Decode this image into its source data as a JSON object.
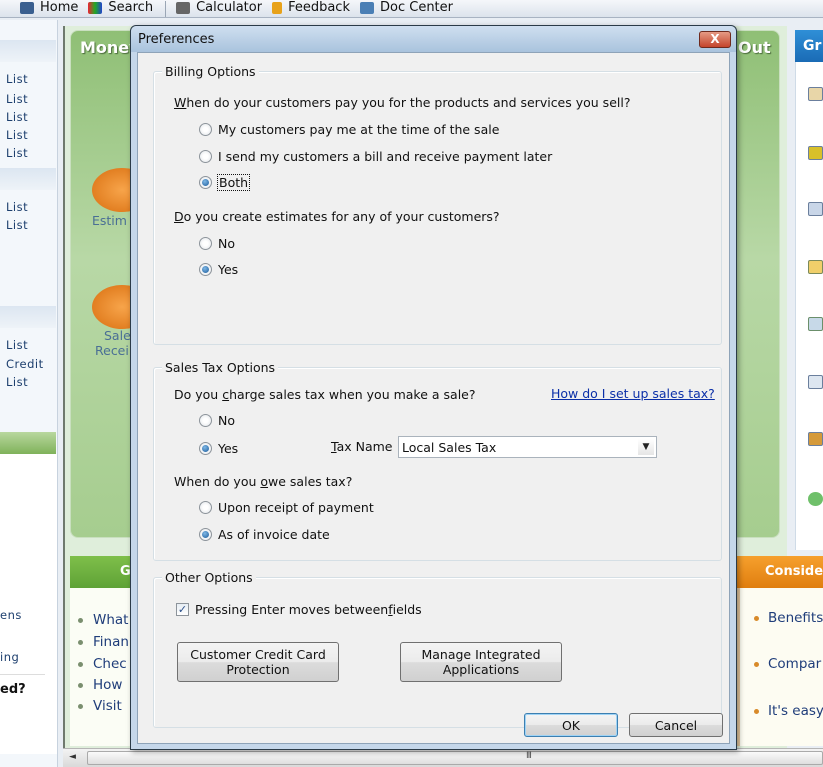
{
  "toolbar": {
    "items": [
      {
        "label": "Home",
        "icon": "home-icon"
      },
      {
        "label": "Search",
        "icon": "search-icon"
      },
      {
        "label": "Calculator",
        "icon": "calculator-icon"
      },
      {
        "label": "Feedback",
        "icon": "feedback-icon"
      },
      {
        "label": "Doc Center",
        "icon": "doc-center-icon"
      }
    ]
  },
  "left_pane": {
    "links_group1": [
      "List",
      "List",
      "List",
      "List",
      "List"
    ],
    "links_group2": [
      "List",
      "List"
    ],
    "links_group3": [
      "List",
      "Credit",
      "List"
    ],
    "fragments": [
      "ens",
      "ing"
    ],
    "question": "ed?"
  },
  "home_panel": {
    "title_left": "Money",
    "title_right": "Out",
    "icon_labels": [
      "Estim",
      "Sale",
      "Recei"
    ],
    "green_box_header": "G",
    "green_box_links": [
      "What",
      "Finan",
      "Chec",
      "How",
      "Visit"
    ],
    "right_header": "Gr",
    "consider_header": "Conside",
    "consider_links": [
      "Benefits",
      "Compar",
      "It's easy"
    ]
  },
  "dialog": {
    "title": "Preferences",
    "close_label": "X",
    "billing": {
      "legend": "Billing Options",
      "q1": {
        "prefix_u": "W",
        "rest": "hen do your customers pay you for the products and services you sell?"
      },
      "q1_options": [
        {
          "label": "My customers pay me at the time of the sale",
          "selected": false
        },
        {
          "label": "I send my customers a bill and receive payment later",
          "selected": false
        },
        {
          "label": "Both",
          "selected": true
        }
      ],
      "q2": {
        "prefix_u": "D",
        "rest": "o you create estimates for any of your customers?"
      },
      "q2_options": [
        {
          "label": "No",
          "selected": false
        },
        {
          "label": "Yes",
          "selected": true
        }
      ]
    },
    "sales_tax": {
      "legend": "Sales Tax Options",
      "q1": {
        "before": "Do you ",
        "u": "c",
        "after": "harge sales tax when you make a sale?"
      },
      "help_link": "How do I set up sales tax?",
      "q1_options": [
        {
          "label": "No",
          "selected": false
        },
        {
          "label": "Yes",
          "selected": true
        }
      ],
      "tax_name_label_u": "T",
      "tax_name_label_rest": "ax Name",
      "tax_name_value": "Local Sales Tax",
      "q2": {
        "before": "When do you ",
        "u": "o",
        "after": "we sales tax?"
      },
      "q2_options": [
        {
          "label": "Upon receipt of payment",
          "selected": false
        },
        {
          "label": "As of invoice date",
          "selected": true
        }
      ]
    },
    "other": {
      "legend": "Other Options",
      "enter_checkbox": {
        "before": "Pressing Enter moves between ",
        "u": "f",
        "after": "ields",
        "checked": true,
        "check_glyph": "✓"
      },
      "credit_card_button": [
        "Customer Credit Card",
        "Protection"
      ],
      "integrated_apps_button": [
        "Manage Integrated",
        "Applications"
      ]
    },
    "ok_label": "OK",
    "cancel_label": "Cancel"
  },
  "scrollbar": {
    "left_arrow": "◄",
    "grip": "III"
  }
}
